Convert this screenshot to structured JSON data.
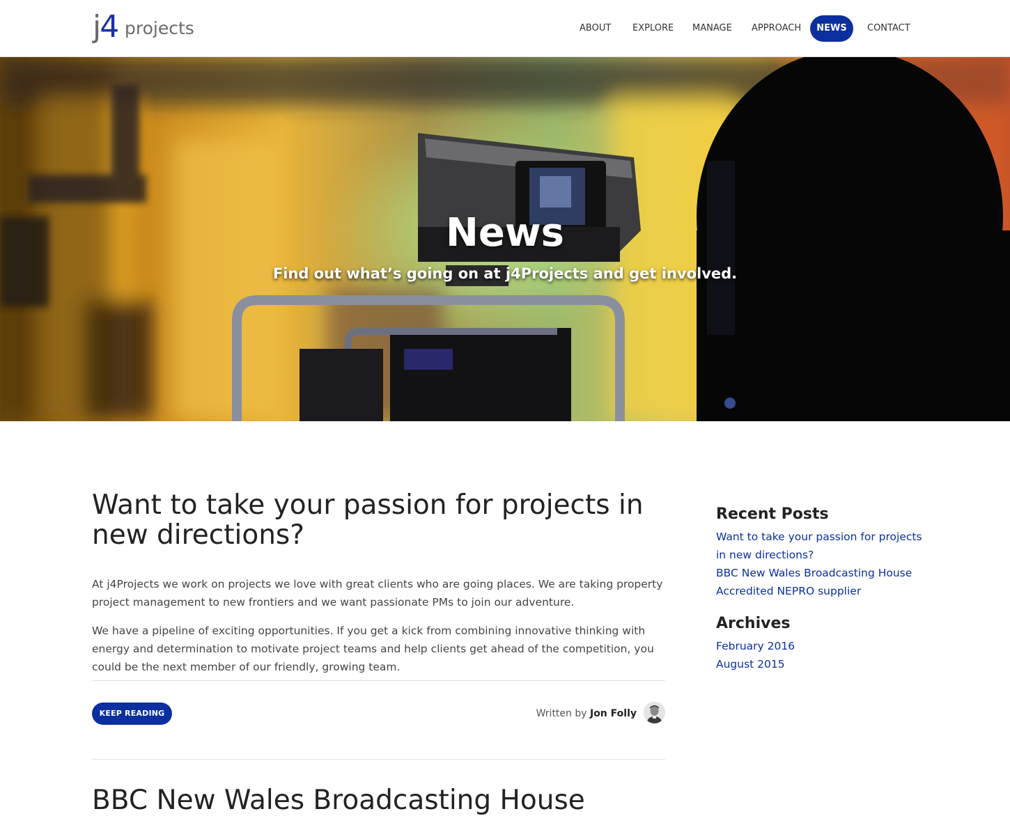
{
  "logo": {
    "mark_j": "j",
    "mark_4": "4",
    "word": "projects"
  },
  "nav": {
    "items": [
      {
        "label": "ABOUT"
      },
      {
        "label": "EXPLORE"
      },
      {
        "label": "MANAGE"
      },
      {
        "label": "APPROACH"
      },
      {
        "label": "NEWS",
        "active": true
      },
      {
        "label": "CONTACT"
      }
    ]
  },
  "hero": {
    "title": "News",
    "subtitle": "Find out what’s going on at j4Projects and get involved."
  },
  "post": {
    "title": "Want to take your passion for projects in new directions?",
    "paragraphs": [
      "At j4Projects we work on projects we love with great clients who are going places. We are taking property project management to new frontiers and we want passionate PMs to join our adventure.",
      "We have a pipeline of exciting opportunities. If you get a kick from combining innovative thinking with energy and determination to motivate project teams and help clients get ahead of the competition, you could be the next member of our friendly, growing team."
    ],
    "keep_reading_label": "KEEP READING",
    "written_by_label": "Written by",
    "author": "Jon Folly"
  },
  "next_post": {
    "title": "BBC New Wales Broadcasting House"
  },
  "sidebar": {
    "recent_heading": "Recent Posts",
    "recent": [
      "Want to take your passion for projects in new directions?",
      "BBC New Wales Broadcasting House",
      "Accredited NEPRO supplier"
    ],
    "archives_heading": "Archives",
    "archives": [
      "February 2016",
      "August 2015"
    ]
  },
  "colors": {
    "brand_blue": "#0c2fa0",
    "logo_blue": "#1b2fa6",
    "logo_grey": "#6a6a6a"
  }
}
